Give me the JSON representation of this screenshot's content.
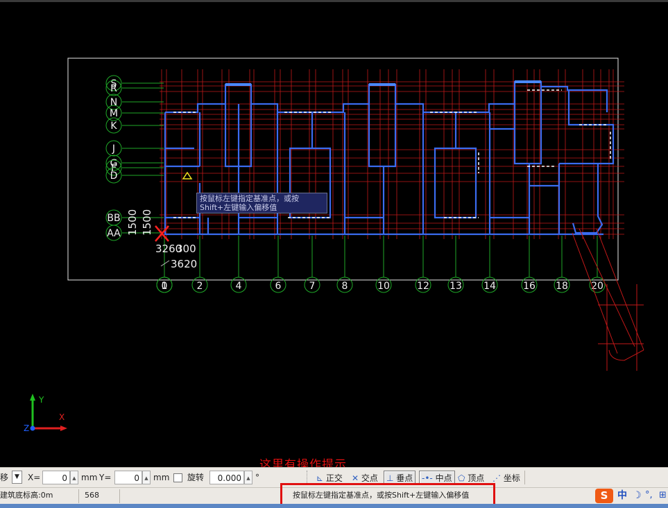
{
  "drawing": {
    "row_axes": [
      "S",
      "R",
      "N",
      "M",
      "K",
      "J",
      "G",
      "F",
      "D",
      "BB",
      "AA"
    ],
    "col_axes": [
      "0",
      "1",
      "2",
      "4",
      "6",
      "7",
      "8",
      "10",
      "12",
      "13",
      "14",
      "16",
      "18",
      "20"
    ],
    "dims_vertical": [
      "1500",
      "1500"
    ],
    "dims_horizontal": [
      "3260",
      "300",
      "3620"
    ],
    "colors": {
      "wall": "#3a6cf0",
      "axis": "#1fa828",
      "grid": "#c21818",
      "bubble": "#1fa828",
      "text": "#f0f0f0",
      "background": "#000000"
    }
  },
  "tooltip": {
    "line1": "按鼠标左键指定基准点，或按",
    "line2": "Shift+左键输入偏移值"
  },
  "annotation": {
    "text": "这里有操作提示"
  },
  "ucs": {
    "x_label": "X",
    "y_label": "Y",
    "z_label": "Z"
  },
  "toolbar": {
    "mode_label": "移",
    "x_label": "X=",
    "x_value": "0",
    "y_label": "Y=",
    "y_value": "0",
    "unit": "mm",
    "unit2": "mm",
    "rotate_label": "旋转",
    "rotate_value": "0.000",
    "degree": "°",
    "snaps": [
      {
        "label": "正交",
        "icon": "ortho-icon",
        "active": false
      },
      {
        "label": "交点",
        "icon": "intersection-icon",
        "active": false
      },
      {
        "label": "垂点",
        "icon": "perpendicular-icon",
        "active": true
      },
      {
        "label": "中点",
        "icon": "midpoint-icon",
        "active": true
      },
      {
        "label": "顶点",
        "icon": "vertex-icon",
        "active": false
      },
      {
        "label": "坐标",
        "icon": "coordinate-icon",
        "active": false
      }
    ]
  },
  "status": {
    "base_elevation": "建筑底标高:0m",
    "count": "568",
    "prompt": "按鼠标左键指定基准点，或按Shift+左键输入偏移值"
  },
  "ime": {
    "logo": "S",
    "lang": "中"
  }
}
